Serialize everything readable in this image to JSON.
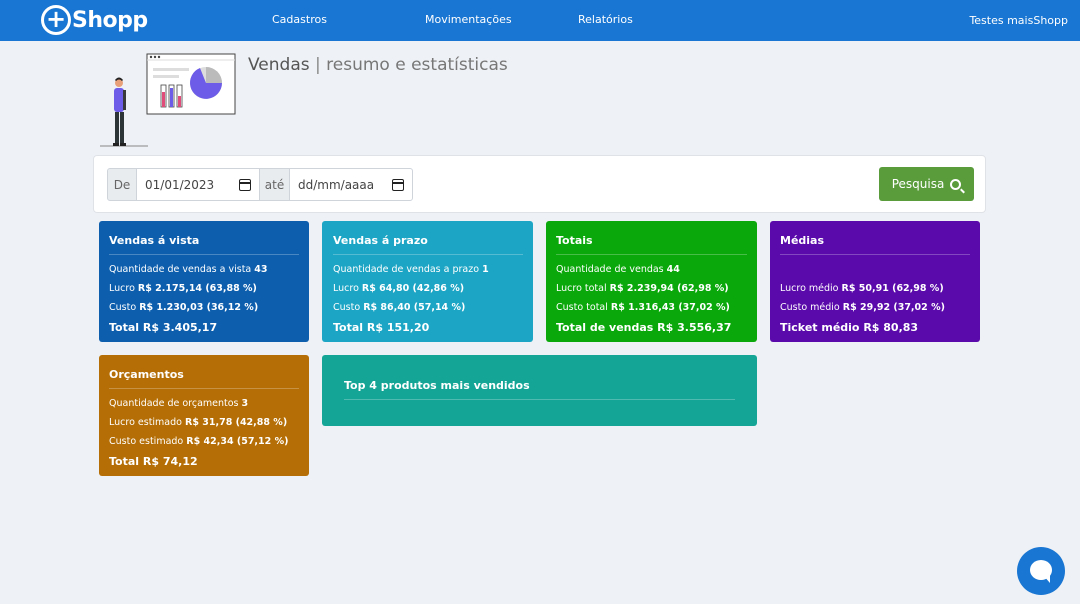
{
  "navbar": {
    "logo_symbol": "+",
    "logo_text": "Shopp",
    "links": [
      "Cadastros",
      "Movimentações",
      "Relatórios"
    ],
    "user": "Testes maisShopp",
    "color": "#1976d2"
  },
  "header": {
    "title": "Vendas",
    "separator": "|",
    "subtitle": "resumo e estatísticas"
  },
  "filter": {
    "from_label": "De",
    "from_value": "01/01/2023",
    "to_label": "até",
    "to_placeholder": "dd/mm/aaaa",
    "search_label": "Pesquisa",
    "search_icon": "search-icon"
  },
  "cards": {
    "avista": {
      "title": "Vendas á vista",
      "qty_label": "Quantidade de vendas a vista",
      "qty_value": "43",
      "profit_label": "Lucro",
      "profit_value": "R$ 2.175,14 (63,88 %)",
      "cost_label": "Custo",
      "cost_value": "R$ 1.230,03 (36,12 %)",
      "total": "Total R$ 3.405,17",
      "color": "#0d5fae"
    },
    "prazo": {
      "title": "Vendas á prazo",
      "qty_label": "Quantidade de vendas a prazo",
      "qty_value": "1",
      "profit_label": "Lucro",
      "profit_value": "R$ 64,80 (42,86 %)",
      "cost_label": "Custo",
      "cost_value": "R$ 86,40 (57,14 %)",
      "total": "Total R$ 151,20",
      "color": "#1ca5c4"
    },
    "totais": {
      "title": "Totais",
      "qty_label": "Quantidade de vendas",
      "qty_value": "44",
      "profit_label": "Lucro total",
      "profit_value": "R$ 2.239,94 (62,98 %)",
      "cost_label": "Custo total",
      "cost_value": "R$ 1.316,43 (37,02 %)",
      "total": "Total de vendas R$ 3.556,37",
      "color": "#0ba80b"
    },
    "medias": {
      "title": "Médias",
      "profit_label": "Lucro médio",
      "profit_value": "R$ 50,91 (62,98 %)",
      "cost_label": "Custo médio",
      "cost_value": "R$ 29,92 (37,02 %)",
      "total": "Ticket médio R$ 80,83",
      "color": "#5a0aaa"
    },
    "orcamentos": {
      "title": "Orçamentos",
      "qty_label": "Quantidade de orçamentos",
      "qty_value": "3",
      "profit_label": "Lucro estimado",
      "profit_value": "R$ 31,78 (42,88 %)",
      "cost_label": "Custo estimado",
      "cost_value": "R$ 42,34 (57,12 %)",
      "total": "Total R$ 74,12",
      "color": "#b46e05"
    },
    "top": {
      "title": "Top 4 produtos mais vendidos",
      "color": "#14a596"
    }
  },
  "chat": {
    "icon": "chat-icon"
  }
}
